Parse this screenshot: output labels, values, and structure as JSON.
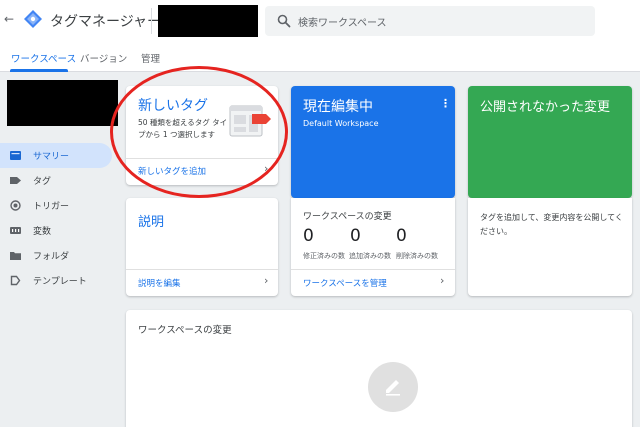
{
  "header": {
    "back_icon": "arrow-back-icon",
    "logo_icon": "tag-manager-logo-icon",
    "app_title": "タグマネージャー",
    "search_placeholder": "検索ワークスペース",
    "search_icon": "search-icon"
  },
  "tabs": [
    {
      "label": "ワークスペース",
      "active": true
    },
    {
      "label": "バージョン",
      "active": false
    },
    {
      "label": "管理",
      "active": false
    }
  ],
  "sidebar": {
    "items": [
      {
        "label": "サマリー",
        "icon": "summary-icon",
        "active": true
      },
      {
        "label": "タグ",
        "icon": "tag-icon",
        "active": false
      },
      {
        "label": "トリガー",
        "icon": "trigger-icon",
        "active": false
      },
      {
        "label": "変数",
        "icon": "variables-icon",
        "active": false
      },
      {
        "label": "フォルダ",
        "icon": "folder-icon",
        "active": false
      },
      {
        "label": "テンプレート",
        "icon": "template-icon",
        "active": false
      }
    ]
  },
  "new_tag_card": {
    "title": "新しいタグ",
    "description": "50 種類を超えるタグ タイプから 1 つ選択します",
    "link": "新しいタグを追加"
  },
  "workspace_card": {
    "title": "現在編集中",
    "subtitle": "Default Workspace",
    "menu_icon": "more-vert-icon"
  },
  "unpublished_card": {
    "title": "公開されなかった変更"
  },
  "description_card": {
    "title": "説明",
    "link": "説明を編集"
  },
  "workspace_changes_card": {
    "title": "ワークスペースの変更",
    "stats": [
      {
        "value": "0",
        "label": "修正済みの数"
      },
      {
        "value": "0",
        "label": "追加済みの数"
      },
      {
        "value": "0",
        "label": "削除済みの数"
      }
    ],
    "link": "ワークスペースを管理"
  },
  "publish_info_card": {
    "text": "タグを追加して、変更内容を公開してください。"
  },
  "bottom_card": {
    "title": "ワークスペースの変更",
    "icon": "edit-pencil-icon"
  },
  "colors": {
    "accent": "#1a73e8",
    "workspace_card": "#1a73e8",
    "unpublished_card": "#34a853",
    "highlight_ring": "#e52420"
  }
}
